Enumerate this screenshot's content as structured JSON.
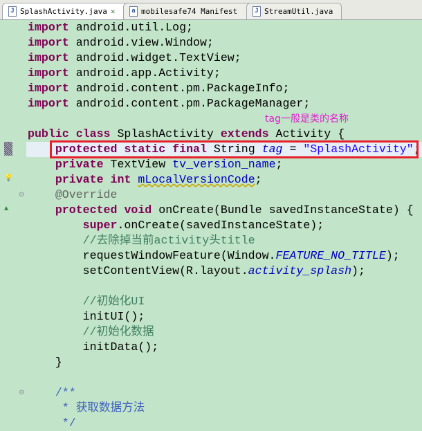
{
  "tabs": [
    {
      "label": "SplashActivity.java",
      "icon": "J",
      "active": true,
      "closable": true
    },
    {
      "label": "mobilesafe74 Manifest",
      "icon": "a",
      "active": false
    },
    {
      "label": "StreamUtil.java",
      "icon": "J",
      "active": false
    }
  ],
  "close_glyph": "✕",
  "annotation": "tag一般是类的名称",
  "code": [
    [
      [
        "import",
        "kw"
      ],
      [
        " android.util.Log;",
        ""
      ]
    ],
    [
      [
        "import",
        "kw"
      ],
      [
        " android.view.Window;",
        ""
      ]
    ],
    [
      [
        "import",
        "kw"
      ],
      [
        " android.widget.TextView;",
        ""
      ]
    ],
    [
      [
        "import",
        "kw"
      ],
      [
        " android.app.Activity;",
        ""
      ]
    ],
    [
      [
        "import",
        "kw"
      ],
      [
        " android.content.pm.PackageInfo;",
        ""
      ]
    ],
    [
      [
        "import",
        "kw"
      ],
      [
        " android.content.pm.PackageManager;",
        ""
      ]
    ],
    [],
    [
      [
        "public",
        "kw"
      ],
      [
        " ",
        ""
      ],
      [
        "class",
        "kw"
      ],
      [
        " SplashActivity ",
        ""
      ],
      [
        "extends",
        "kw"
      ],
      [
        " Activity {",
        ""
      ]
    ],
    [
      [
        "    ",
        ""
      ],
      [
        "protected",
        "kw"
      ],
      [
        " ",
        ""
      ],
      [
        "static",
        "kw"
      ],
      [
        " ",
        ""
      ],
      [
        "final",
        "kw"
      ],
      [
        " String ",
        ""
      ],
      [
        "tag",
        "fld ital"
      ],
      [
        " = ",
        ""
      ],
      [
        "\"SplashActivity\"",
        "str"
      ],
      [
        ";",
        ""
      ]
    ],
    [
      [
        "    ",
        ""
      ],
      [
        "private",
        "kw"
      ],
      [
        " TextView ",
        ""
      ],
      [
        "tv_version_name",
        "fld"
      ],
      [
        ";",
        ""
      ]
    ],
    [
      [
        "    ",
        ""
      ],
      [
        "private",
        "kw"
      ],
      [
        " ",
        ""
      ],
      [
        "int",
        "kw"
      ],
      [
        " ",
        ""
      ],
      [
        "mLocalVersionCode",
        "fld warn"
      ],
      [
        ";",
        ""
      ]
    ],
    [
      [
        "    ",
        ""
      ],
      [
        "@Override",
        "ann"
      ]
    ],
    [
      [
        "    ",
        ""
      ],
      [
        "protected",
        "kw"
      ],
      [
        " ",
        ""
      ],
      [
        "void",
        "kw"
      ],
      [
        " onCreate(Bundle savedInstanceState) {",
        ""
      ]
    ],
    [
      [
        "        ",
        ""
      ],
      [
        "super",
        "kw"
      ],
      [
        ".onCreate(savedInstanceState);",
        ""
      ]
    ],
    [
      [
        "        ",
        ""
      ],
      [
        "//去除掉当前activity头title",
        "cm"
      ]
    ],
    [
      [
        "        requestWindowFeature(Window.",
        ""
      ],
      [
        "FEATURE_NO_TITLE",
        "fld ital"
      ],
      [
        ");",
        ""
      ]
    ],
    [
      [
        "        setContentView(R.layout.",
        ""
      ],
      [
        "activity_splash",
        "fld ital"
      ],
      [
        ");",
        ""
      ]
    ],
    [],
    [
      [
        "        ",
        ""
      ],
      [
        "//初始化UI",
        "cm"
      ]
    ],
    [
      [
        "        initUI();",
        ""
      ]
    ],
    [
      [
        "        ",
        ""
      ],
      [
        "//初始化数据",
        "cm"
      ]
    ],
    [
      [
        "        initData();",
        ""
      ]
    ],
    [
      [
        "    }",
        ""
      ]
    ],
    [],
    [
      [
        "    ",
        ""
      ],
      [
        "/**",
        "jd"
      ]
    ],
    [
      [
        "     ",
        ""
      ],
      [
        "* 获取数据方法",
        "jd"
      ]
    ],
    [
      [
        "     ",
        ""
      ],
      [
        "*/",
        "jd"
      ]
    ]
  ]
}
